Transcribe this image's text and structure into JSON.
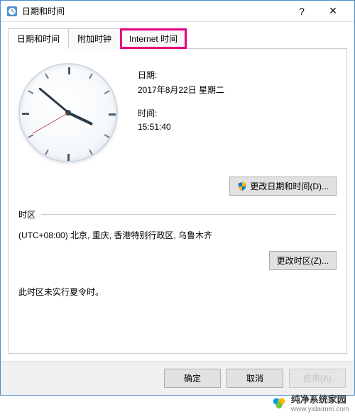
{
  "window": {
    "title": "日期和时间",
    "icon": "datetime-icon"
  },
  "tabs": [
    {
      "label": "日期和时间",
      "active": true
    },
    {
      "label": "附加时钟",
      "active": false
    },
    {
      "label": "Internet 时间",
      "active": false,
      "highlighted": true
    }
  ],
  "datePanel": {
    "dateLabel": "日期:",
    "dateValue": "2017年8月22日 星期二",
    "timeLabel": "时间:",
    "timeValue": "15:51:40",
    "changeDateTimeBtn": "更改日期和时间(D)..."
  },
  "clock": {
    "hour": 15,
    "minute": 51,
    "second": 40
  },
  "timezone": {
    "sectionLabel": "时区",
    "value": "(UTC+08:00) 北京, 重庆, 香港特别行政区, 乌鲁木齐",
    "changeBtn": "更改时区(Z)..."
  },
  "dst": {
    "text": "此时区未实行夏令时。"
  },
  "buttons": {
    "ok": "确定",
    "cancel": "取消",
    "apply": "应用(A)"
  },
  "watermark": {
    "text": "纯净系统家园",
    "sub": "www.yidaimei.com"
  }
}
